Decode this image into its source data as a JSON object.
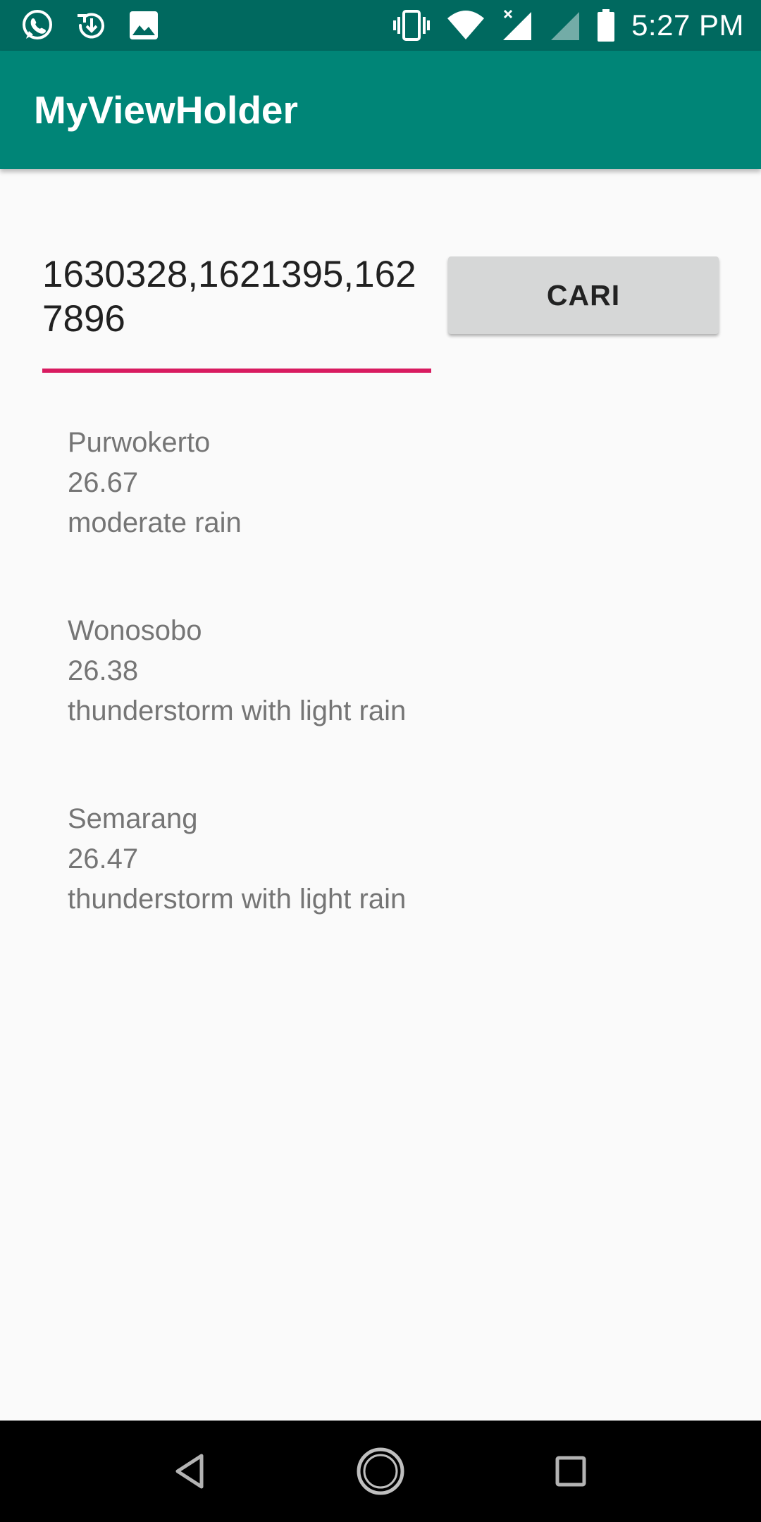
{
  "status_bar": {
    "time": "5:27 PM",
    "left_icons": [
      "whatsapp-icon",
      "download-icon",
      "image-icon"
    ],
    "right_icons": [
      "vibrate-icon",
      "wifi-icon",
      "signal-icon",
      "signal-icon",
      "battery-icon"
    ]
  },
  "app_bar": {
    "title": "MyViewHolder"
  },
  "search": {
    "value": "1630328,1621395,1627896",
    "button_label": "CARI"
  },
  "weather": [
    {
      "city": "Purwokerto",
      "temp": "26.67",
      "description": "moderate rain"
    },
    {
      "city": "Wonosobo",
      "temp": "26.38",
      "description": "thunderstorm with light rain"
    },
    {
      "city": "Semarang",
      "temp": "26.47",
      "description": "thunderstorm with light rain"
    }
  ],
  "nav_bar": {
    "buttons": [
      "back-icon",
      "home-icon",
      "recents-icon"
    ]
  },
  "colors": {
    "status_bar": "#00695f",
    "app_bar": "#008577",
    "accent": "#d81b60",
    "button": "#d6d7d7",
    "background": "#fafafa"
  }
}
